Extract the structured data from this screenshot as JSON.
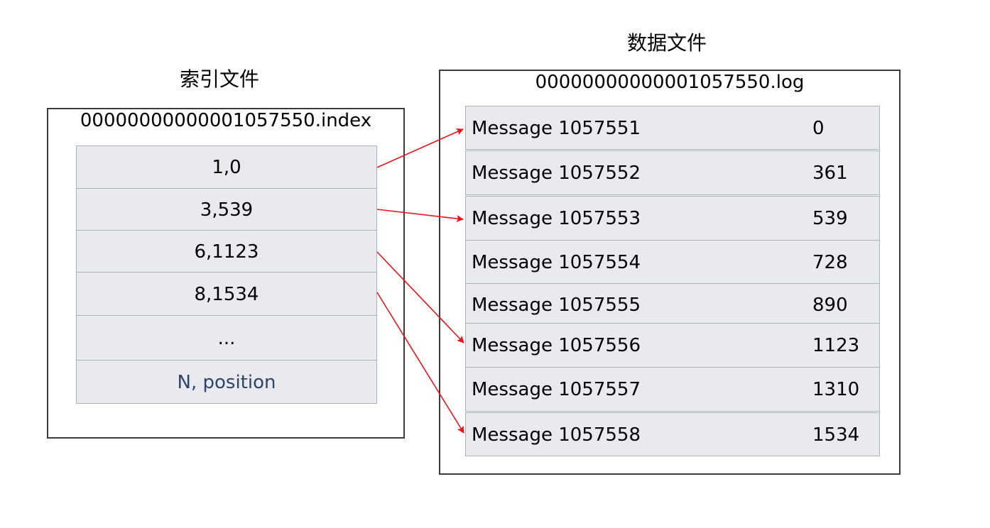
{
  "index_file": {
    "title": "索引文件",
    "filename": "00000000000001057550.index",
    "entries": [
      {
        "label": "1,0"
      },
      {
        "label": "3,539"
      },
      {
        "label": "6,1123"
      },
      {
        "label": "8,1534"
      },
      {
        "label": "..."
      },
      {
        "label": "N, position"
      }
    ]
  },
  "data_file": {
    "title": "数据文件",
    "filename": "00000000000001057550.log",
    "messages": [
      {
        "name": "Message 1057551",
        "position": "0"
      },
      {
        "name": "Message 1057552",
        "position": "361"
      },
      {
        "name": "Message 1057553",
        "position": "539"
      },
      {
        "name": "Message 1057554",
        "position": "728"
      },
      {
        "name": "Message 1057555",
        "position": "890"
      },
      {
        "name": "Message 1057556",
        "position": "1123"
      },
      {
        "name": "Message 1057557",
        "position": "1310"
      },
      {
        "name": "Message 1057558",
        "position": "1534"
      }
    ]
  },
  "links": [
    {
      "from_index": 0,
      "to_message": 0
    },
    {
      "from_index": 1,
      "to_message": 2
    },
    {
      "from_index": 2,
      "to_message": 5
    },
    {
      "from_index": 3,
      "to_message": 7
    }
  ],
  "colors": {
    "arrow": "#e8141a",
    "cell_fill": "#e8eaee",
    "cell_border": "#aab2bf",
    "muted_text": "#2f4468"
  }
}
